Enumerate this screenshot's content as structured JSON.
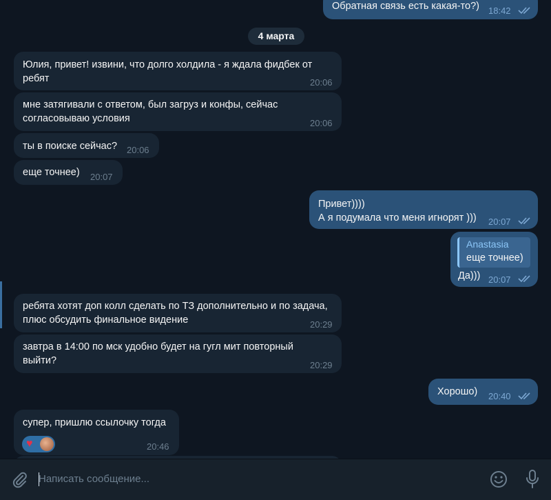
{
  "date_divider": "4 марта",
  "messages": [
    {
      "text": "Обратная связь есть какая-то?)",
      "time": "18:42"
    },
    {
      "text": "Юлия, привет! извини, что долго холдила - я ждала фидбек от\nребят",
      "time": "20:06"
    },
    {
      "text": "мне затягивали с ответом, был загруз и конфы, сейчас\nсогласовываю условия",
      "time": "20:06"
    },
    {
      "text": "ты в поиске сейчас?",
      "time": "20:06"
    },
    {
      "text": "еще точнее)",
      "time": "20:07"
    },
    {
      "text": "Привет))))\nА я подумала что меня игнорят )))",
      "time": "20:07"
    },
    {
      "quote_author": "Anastasia",
      "quote_text": "еще точнее)",
      "text": "Да)))",
      "time": "20:07"
    },
    {
      "text": "ребята хотят доп колл сделать по ТЗ дополнительно и по задача,\nплюс обсудить финальное видение",
      "time": "20:29"
    },
    {
      "text": "завтра в 14:00 по мск удобно будет на гугл мит повторный\nвыйти?",
      "time": "20:29"
    },
    {
      "text": "Хорошо)",
      "time": "20:40"
    },
    {
      "text": "супер, пришлю ссылочку тогда",
      "time": "20:46",
      "reaction": "heart"
    }
  ],
  "composer": {
    "placeholder": "Написать сообщение..."
  },
  "icons": {
    "attach": "paperclip-icon",
    "emoji": "smile-icon",
    "voice": "microphone-icon",
    "read": "double-check-icon"
  },
  "colors": {
    "background": "#0e1621",
    "incoming": "#182533",
    "outgoing": "#2b5278",
    "accent": "#8cc6f7",
    "read_check": "#7da8d3"
  }
}
